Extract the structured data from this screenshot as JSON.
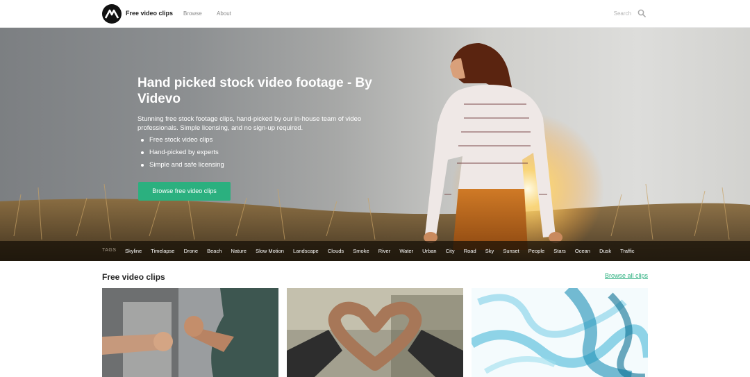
{
  "header": {
    "brand": "Free video clips",
    "nav": [
      "Browse",
      "About"
    ],
    "search_label": "Search"
  },
  "hero": {
    "title": "Hand picked stock video footage - By Videvo",
    "description": "Stunning free stock footage clips, hand-picked by our in-house team of video professionals. Simple licensing, and no sign-up required.",
    "bullets": [
      "Free stock video clips",
      "Hand-picked by experts",
      "Simple and safe licensing"
    ],
    "cta_label": "Browse free video clips"
  },
  "tags": {
    "label": "TAGS",
    "items": [
      "Skyline",
      "Timelapse",
      "Drone",
      "Beach",
      "Nature",
      "Slow Motion",
      "Landscape",
      "Clouds",
      "Smoke",
      "River",
      "Water",
      "Urban",
      "City",
      "Road",
      "Sky",
      "Sunset",
      "People",
      "Stars",
      "Ocean",
      "Dusk",
      "Traffic"
    ]
  },
  "section": {
    "title": "Free video clips",
    "browse_all": "Browse all clips"
  },
  "colors": {
    "accent": "#2bb07f",
    "tagbar": "#1a120a"
  },
  "icons": [
    "videvo-logo-icon",
    "search-icon"
  ]
}
